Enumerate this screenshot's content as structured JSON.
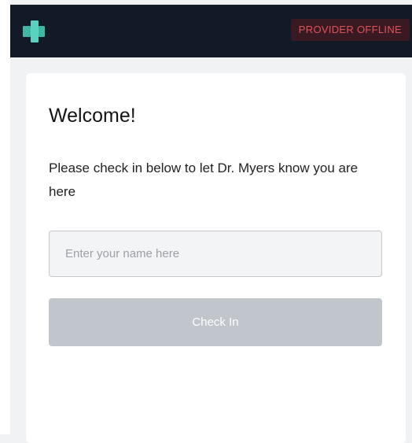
{
  "header": {
    "logo_icon": "medical-cross-logo-icon",
    "status_badge": "PROVIDER OFFLINE",
    "status_color": "#e0525a"
  },
  "card": {
    "title": "Welcome!",
    "instructions": "Please check in below to let Dr. Myers know you are here",
    "name_input": {
      "value": "",
      "placeholder": "Enter your name here"
    },
    "checkin_button_label": "Check In"
  },
  "colors": {
    "header_bg": "#121a27",
    "logo_accent": "#4fc9b7",
    "button_disabled": "#c1c5cc"
  }
}
